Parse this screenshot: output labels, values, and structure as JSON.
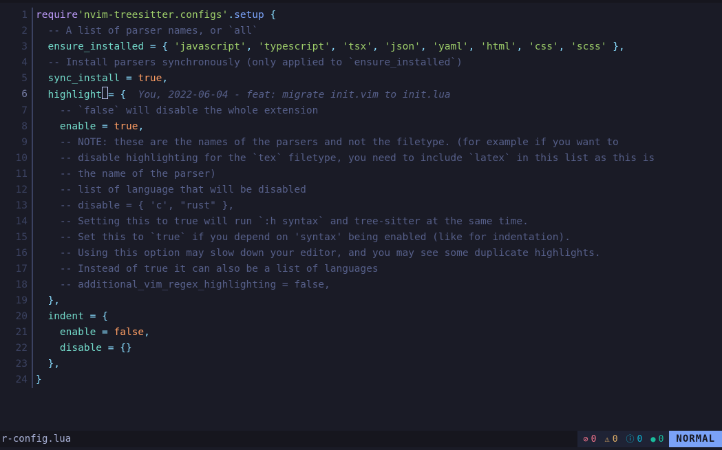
{
  "filename": "r-config.lua",
  "mode": "NORMAL",
  "cursor_line": 6,
  "diagnostics": {
    "errors": "0",
    "warnings": "0",
    "info": "0",
    "hints": "0"
  },
  "lines": [
    {
      "n": 1,
      "indent": 0,
      "tokens": [
        {
          "t": "require",
          "c": "tok-kw"
        },
        {
          "t": "'nvim-treesitter.configs'",
          "c": "tok-str"
        },
        {
          "t": ".",
          "c": "tok-punc"
        },
        {
          "t": "setup",
          "c": "tok-fn"
        },
        {
          "t": " ",
          "c": ""
        },
        {
          "t": "{",
          "c": "tok-punc"
        }
      ]
    },
    {
      "n": 2,
      "indent": 1,
      "tokens": [
        {
          "t": "-- A list of parser names, or `all`",
          "c": "tok-cmt"
        }
      ]
    },
    {
      "n": 3,
      "indent": 1,
      "tokens": [
        {
          "t": "ensure_installed",
          "c": "tok-prop"
        },
        {
          "t": " ",
          "c": ""
        },
        {
          "t": "=",
          "c": "tok-punc"
        },
        {
          "t": " ",
          "c": ""
        },
        {
          "t": "{",
          "c": "tok-punc"
        },
        {
          "t": " ",
          "c": ""
        },
        {
          "t": "'javascript'",
          "c": "tok-str"
        },
        {
          "t": ",",
          "c": "tok-punc"
        },
        {
          "t": " ",
          "c": ""
        },
        {
          "t": "'typescript'",
          "c": "tok-str"
        },
        {
          "t": ",",
          "c": "tok-punc"
        },
        {
          "t": " ",
          "c": ""
        },
        {
          "t": "'tsx'",
          "c": "tok-str"
        },
        {
          "t": ",",
          "c": "tok-punc"
        },
        {
          "t": " ",
          "c": ""
        },
        {
          "t": "'json'",
          "c": "tok-str"
        },
        {
          "t": ",",
          "c": "tok-punc"
        },
        {
          "t": " ",
          "c": ""
        },
        {
          "t": "'yaml'",
          "c": "tok-str"
        },
        {
          "t": ",",
          "c": "tok-punc"
        },
        {
          "t": " ",
          "c": ""
        },
        {
          "t": "'html'",
          "c": "tok-str"
        },
        {
          "t": ",",
          "c": "tok-punc"
        },
        {
          "t": " ",
          "c": ""
        },
        {
          "t": "'css'",
          "c": "tok-str"
        },
        {
          "t": ",",
          "c": "tok-punc"
        },
        {
          "t": " ",
          "c": ""
        },
        {
          "t": "'scss'",
          "c": "tok-str"
        },
        {
          "t": " ",
          "c": ""
        },
        {
          "t": "}",
          "c": "tok-punc"
        },
        {
          "t": ",",
          "c": "tok-punc"
        }
      ]
    },
    {
      "n": 4,
      "indent": 1,
      "tokens": [
        {
          "t": "-- Install parsers synchronously (only applied to `ensure_installed`)",
          "c": "tok-cmt"
        }
      ]
    },
    {
      "n": 5,
      "indent": 1,
      "tokens": [
        {
          "t": "sync_install",
          "c": "tok-prop"
        },
        {
          "t": " ",
          "c": ""
        },
        {
          "t": "=",
          "c": "tok-punc"
        },
        {
          "t": " ",
          "c": ""
        },
        {
          "t": "true",
          "c": "tok-bool"
        },
        {
          "t": ",",
          "c": "tok-punc"
        }
      ]
    },
    {
      "n": 6,
      "indent": 1,
      "tokens": [
        {
          "t": "highlight",
          "c": "tok-prop"
        },
        {
          "cursor": true
        },
        {
          "t": "=",
          "c": "tok-punc"
        },
        {
          "t": " ",
          "c": ""
        },
        {
          "t": "{",
          "c": "tok-punc"
        },
        {
          "t": "  ",
          "c": ""
        },
        {
          "t": "You, 2022-06-04 - feat: migrate init.vim to init.lua",
          "c": "tok-blame"
        }
      ]
    },
    {
      "n": 7,
      "indent": 2,
      "tokens": [
        {
          "t": "-- `false` will disable the whole extension",
          "c": "tok-cmt"
        }
      ]
    },
    {
      "n": 8,
      "indent": 2,
      "tokens": [
        {
          "t": "enable",
          "c": "tok-prop"
        },
        {
          "t": " ",
          "c": ""
        },
        {
          "t": "=",
          "c": "tok-punc"
        },
        {
          "t": " ",
          "c": ""
        },
        {
          "t": "true",
          "c": "tok-bool"
        },
        {
          "t": ",",
          "c": "tok-punc"
        }
      ]
    },
    {
      "n": 9,
      "indent": 2,
      "tokens": [
        {
          "t": "-- NOTE: these are the names of the parsers and not the filetype. (for example if you want to",
          "c": "tok-cmt"
        }
      ]
    },
    {
      "n": 10,
      "indent": 2,
      "tokens": [
        {
          "t": "-- disable highlighting for the `tex` filetype, you need to include `latex` in this list as this is",
          "c": "tok-cmt"
        }
      ]
    },
    {
      "n": 11,
      "indent": 2,
      "tokens": [
        {
          "t": "-- the name of the parser)",
          "c": "tok-cmt"
        }
      ]
    },
    {
      "n": 12,
      "indent": 2,
      "tokens": [
        {
          "t": "-- list of language that will be disabled",
          "c": "tok-cmt"
        }
      ]
    },
    {
      "n": 13,
      "indent": 2,
      "tokens": [
        {
          "t": "-- disable = { 'c', \"rust\" },",
          "c": "tok-cmt"
        }
      ]
    },
    {
      "n": 14,
      "indent": 2,
      "tokens": [
        {
          "t": "-- Setting this to true will run `:h syntax` and tree-sitter at the same time.",
          "c": "tok-cmt"
        }
      ]
    },
    {
      "n": 15,
      "indent": 2,
      "tokens": [
        {
          "t": "-- Set this to `true` if you depend on 'syntax' being enabled (like for indentation).",
          "c": "tok-cmt"
        }
      ]
    },
    {
      "n": 16,
      "indent": 2,
      "tokens": [
        {
          "t": "-- Using this option may slow down your editor, and you may see some duplicate highlights.",
          "c": "tok-cmt"
        }
      ]
    },
    {
      "n": 17,
      "indent": 2,
      "tokens": [
        {
          "t": "-- Instead of true it can also be a list of languages",
          "c": "tok-cmt"
        }
      ]
    },
    {
      "n": 18,
      "indent": 2,
      "tokens": [
        {
          "t": "-- additional_vim_regex_highlighting = false,",
          "c": "tok-cmt"
        }
      ]
    },
    {
      "n": 19,
      "indent": 1,
      "tokens": [
        {
          "t": "}",
          "c": "tok-punc"
        },
        {
          "t": ",",
          "c": "tok-punc"
        }
      ]
    },
    {
      "n": 20,
      "indent": 1,
      "tokens": [
        {
          "t": "indent",
          "c": "tok-prop"
        },
        {
          "t": " ",
          "c": ""
        },
        {
          "t": "=",
          "c": "tok-punc"
        },
        {
          "t": " ",
          "c": ""
        },
        {
          "t": "{",
          "c": "tok-punc"
        }
      ]
    },
    {
      "n": 21,
      "indent": 2,
      "tokens": [
        {
          "t": "enable",
          "c": "tok-prop"
        },
        {
          "t": " ",
          "c": ""
        },
        {
          "t": "=",
          "c": "tok-punc"
        },
        {
          "t": " ",
          "c": ""
        },
        {
          "t": "false",
          "c": "tok-bool"
        },
        {
          "t": ",",
          "c": "tok-punc"
        }
      ]
    },
    {
      "n": 22,
      "indent": 2,
      "tokens": [
        {
          "t": "disable",
          "c": "tok-prop"
        },
        {
          "t": " ",
          "c": ""
        },
        {
          "t": "=",
          "c": "tok-punc"
        },
        {
          "t": " ",
          "c": ""
        },
        {
          "t": "{}",
          "c": "tok-punc"
        }
      ]
    },
    {
      "n": 23,
      "indent": 1,
      "tokens": [
        {
          "t": "}",
          "c": "tok-punc"
        },
        {
          "t": ",",
          "c": "tok-punc"
        }
      ]
    },
    {
      "n": 24,
      "indent": 0,
      "tokens": [
        {
          "t": "}",
          "c": "tok-punc"
        }
      ]
    }
  ]
}
